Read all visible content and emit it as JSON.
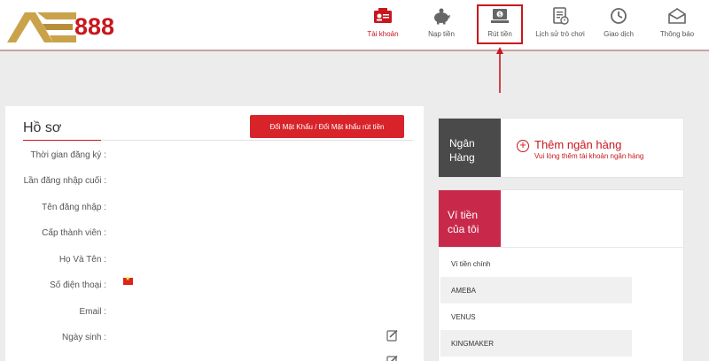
{
  "header": {
    "logo": {
      "left_text": "AE",
      "right_text": "888"
    },
    "nav": [
      {
        "label": "Tài khoản",
        "icon": "account-card-icon",
        "active": true
      },
      {
        "label": "Nạp tiền",
        "icon": "piggy-bank-icon",
        "active": false
      },
      {
        "label": "Rút tiền",
        "icon": "withdraw-cash-icon",
        "active": false,
        "highlighted": true
      },
      {
        "label": "Lịch sử trò chơi",
        "icon": "game-history-icon",
        "active": false
      },
      {
        "label": "Giao dịch",
        "icon": "transaction-clock-icon",
        "active": false
      },
      {
        "label": "Thông báo",
        "icon": "notification-mail-icon",
        "active": false
      }
    ]
  },
  "profile": {
    "title": "Hồ sơ",
    "change_password_button": "Đổi Mật Khẩu / Đổi Mật khẩu rút tiền",
    "fields": [
      {
        "label": "Thời gian đăng ký :"
      },
      {
        "label": "Lần đăng nhập cuối :"
      },
      {
        "label": "Tên đăng nhập :"
      },
      {
        "label": "Cấp thành viên :"
      },
      {
        "label": "Họ Và Tên :"
      },
      {
        "label": "Số điện thoại :"
      },
      {
        "label": "Email :"
      },
      {
        "label": "Ngày sinh :"
      }
    ]
  },
  "bank": {
    "tab_line1": "Ngân",
    "tab_line2": "Hàng",
    "add_title": "Thêm ngân hàng",
    "add_subtitle": "Vui lòng thêm tài khoản ngân hàng"
  },
  "wallet": {
    "tab_line1": "Ví tiền",
    "tab_line2": "của tôi",
    "items": [
      "Ví tiền chính",
      "AMEBA",
      "VENUS",
      "KINGMAKER"
    ]
  },
  "colors": {
    "brand_red": "#c8171e",
    "button_red": "#d8232a",
    "wallet_tab": "#c8294b",
    "bank_tab": "#4a4a4a",
    "logo_gold": "#c9a24a"
  }
}
